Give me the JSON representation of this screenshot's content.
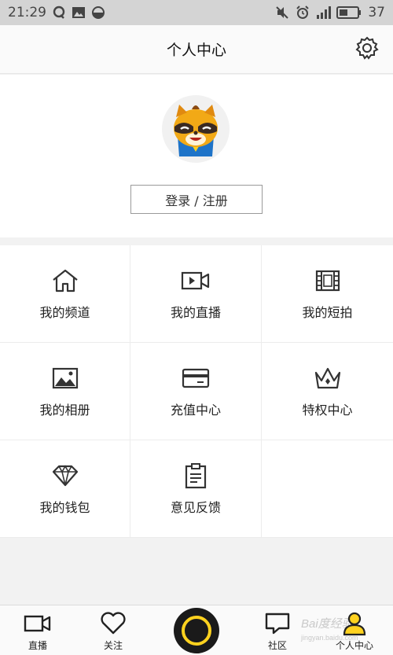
{
  "status_bar": {
    "time": "21:29",
    "battery": "37",
    "icons_left": [
      "qq-icon",
      "image-icon",
      "moon-icon"
    ],
    "icons_right": [
      "mute-icon",
      "alarm-icon",
      "signal-icon",
      "battery-icon"
    ]
  },
  "header": {
    "title": "个人中心",
    "settings_icon": "gear-icon"
  },
  "profile": {
    "avatar_icon": "raccoon-mascot-avatar",
    "login_label": "登录 / 注册"
  },
  "menu": [
    {
      "label": "我的频道",
      "icon": "home-icon"
    },
    {
      "label": "我的直播",
      "icon": "video-camera-icon"
    },
    {
      "label": "我的短拍",
      "icon": "film-icon"
    },
    {
      "label": "我的相册",
      "icon": "picture-icon"
    },
    {
      "label": "充值中心",
      "icon": "card-icon"
    },
    {
      "label": "特权中心",
      "icon": "crown-icon"
    },
    {
      "label": "我的钱包",
      "icon": "diamond-icon"
    },
    {
      "label": "意见反馈",
      "icon": "clipboard-icon"
    }
  ],
  "tabs": [
    {
      "label": "直播",
      "icon": "video-camera-icon"
    },
    {
      "label": "关注",
      "icon": "heart-icon"
    },
    {
      "label": "社区",
      "icon": "chat-bubble-icon"
    },
    {
      "label": "个人中心",
      "icon": "person-icon"
    }
  ],
  "watermark": {
    "text": "Bai度经验",
    "sub": "jingyan.baidu.com"
  },
  "colors": {
    "accent": "#ffd21f",
    "status_bar": "#d4d4d4",
    "background": "#f2f2f2"
  }
}
